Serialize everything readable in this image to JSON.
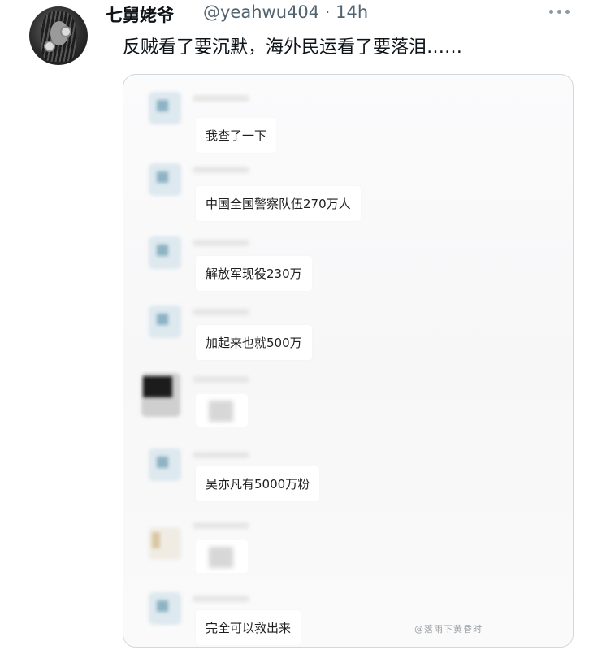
{
  "header": {
    "display_name": "七舅姥爷",
    "handle": "@yeahwu404",
    "separator": "·",
    "time": "14h",
    "meta": "@yeahwu404 · 14h"
  },
  "tweet": {
    "text": "反贼看了要沉默，海外民运看了要落泪……"
  },
  "media": {
    "messages": [
      {
        "text": "我查了一下",
        "avatar": "blue"
      },
      {
        "text": "中国全国警察队伍270万人",
        "avatar": "blue"
      },
      {
        "text": "解放军现役230万",
        "avatar": "blue"
      },
      {
        "text": "加起来也就500万",
        "avatar": "blue"
      },
      {
        "text": "",
        "avatar": "dark",
        "blurred": true
      },
      {
        "text": "吴亦凡有5000万粉",
        "avatar": "blue"
      },
      {
        "text": "",
        "avatar": "light",
        "blurred": true
      },
      {
        "text": "完全可以救出来",
        "avatar": "blue"
      }
    ],
    "watermark": "@落雨下黄昏时"
  },
  "icons": {
    "more": "more-horizontal-icon",
    "avatar": "user-avatar"
  }
}
